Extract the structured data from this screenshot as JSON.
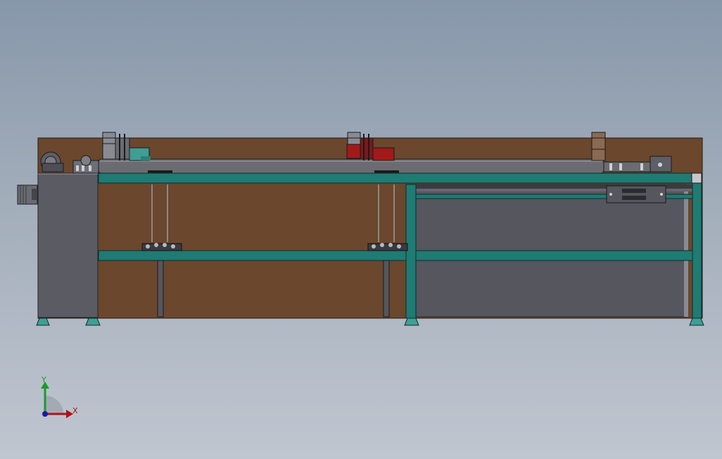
{
  "triad": {
    "x_label": "X",
    "y_label": "Y",
    "x_color": "#b0101a",
    "y_color": "#1a9a2a",
    "z_color": "#1a1aa0"
  },
  "colors": {
    "background": "#98a4b4",
    "frame_teal": "#1f7b74",
    "back_panel_brown": "#6a472d",
    "panel_gray": "#55565e",
    "motor_teal": "#3f9e95",
    "motor_red": "#a11a1a",
    "roller_gray": "#6b6c72"
  }
}
